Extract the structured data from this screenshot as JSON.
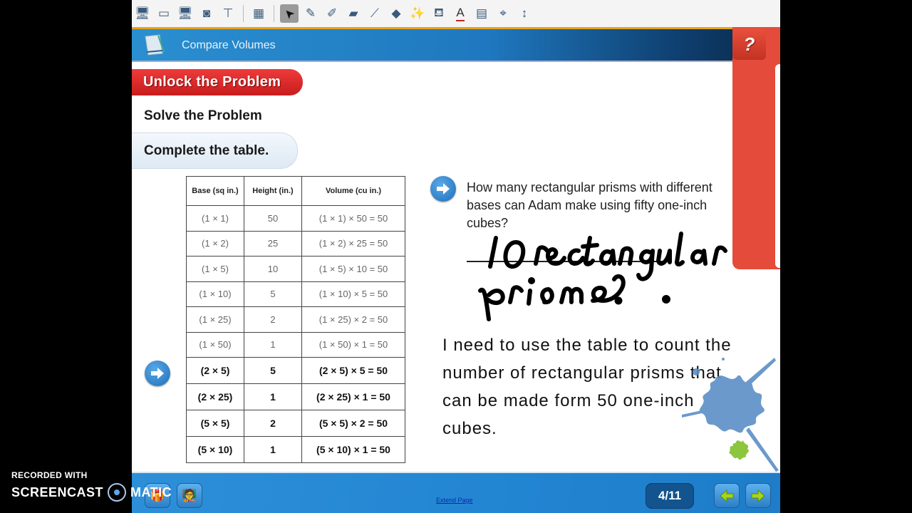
{
  "toolbar": {
    "tools": [
      {
        "icon": "monitor-blue-icon",
        "glyph": "🖥"
      },
      {
        "icon": "monitor-blank-icon",
        "glyph": "▭"
      },
      {
        "icon": "monitor-book-icon",
        "glyph": "🖥"
      },
      {
        "icon": "camera-icon",
        "glyph": "◙"
      },
      {
        "icon": "document-camera-icon",
        "glyph": "⊤"
      },
      {
        "icon": "table-icon",
        "glyph": "▦"
      },
      {
        "icon": "select-pointer-icon",
        "glyph": "➤"
      },
      {
        "icon": "pen-icon",
        "glyph": "✎"
      },
      {
        "icon": "highlighter-icon",
        "glyph": "✐"
      },
      {
        "icon": "eraser-icon",
        "glyph": "▰"
      },
      {
        "icon": "line-icon",
        "glyph": "⟋"
      },
      {
        "icon": "shapes-icon",
        "glyph": "◆"
      },
      {
        "icon": "magic-pen-icon",
        "glyph": "✨"
      },
      {
        "icon": "fill-bucket-icon",
        "glyph": "⛾"
      },
      {
        "icon": "text-icon",
        "glyph": "A"
      },
      {
        "icon": "text-format-icon",
        "glyph": "▤"
      },
      {
        "icon": "compass-icon",
        "glyph": "⌖"
      },
      {
        "icon": "resize-vertical-icon",
        "glyph": "↕"
      }
    ]
  },
  "header": {
    "title": "Compare Volumes",
    "help_label": "?"
  },
  "lesson": {
    "unlock_label": "Unlock the Problem",
    "solve_label": "Solve the Problem",
    "instruction": "Complete the table."
  },
  "table": {
    "headers": [
      "Base (sq in.)",
      "Height (in.)",
      "Volume (cu in.)"
    ],
    "rows": [
      {
        "base": "(1 × 1)",
        "height": "50",
        "volume": "(1 × 1) × 50 = 50"
      },
      {
        "base": "(1 × 2)",
        "height": "25",
        "volume": "(1 × 2) × 25 = 50"
      },
      {
        "base": "(1 × 5)",
        "height": "10",
        "volume": "(1 × 5) × 10 = 50"
      },
      {
        "base": "(1 × 10)",
        "height": "5",
        "volume": "(1 × 10) × 5 = 50"
      },
      {
        "base": "(1 × 25)",
        "height": "2",
        "volume": "(1 × 25) × 2 = 50"
      },
      {
        "base": "(1 × 50)",
        "height": "1",
        "volume": "(1 × 50) × 1 = 50"
      },
      {
        "base": "(2 × 5)",
        "height": "5",
        "volume": "(2 × 5) × 5 = 50"
      },
      {
        "base": "(2 × 25)",
        "height": "1",
        "volume": "(2 × 25) × 1 = 50"
      },
      {
        "base": "(5 × 5)",
        "height": "2",
        "volume": "(5 × 5) × 2 = 50"
      },
      {
        "base": "(5 × 10)",
        "height": "1",
        "volume": "(5 × 10) × 1 = 50"
      }
    ]
  },
  "question": {
    "text": "How many rectangular prisms with different bases can Adam make using fifty one-inch cubes?",
    "handwritten_answer": "10 rectangular prisms."
  },
  "explanation": "I need to use the table to count the number of rectangular prisms that can be made form 50 one-inch cubes.",
  "bottombar": {
    "extend_page_label": "Extend Page",
    "page_indicator": "4/11",
    "current_page": 4,
    "total_pages": 11
  },
  "watermark": {
    "line1": "RECORDED WITH",
    "line2a": "SCREENCAST",
    "line2b": "MATIC"
  },
  "colors": {
    "header_blue": "#1f78bf",
    "unlock_red": "#d92525",
    "help_red": "#e54b3a",
    "toolbar_accent": "#e7a21b",
    "splat_blue": "#5b8ec6",
    "splat_green": "#8cc63f"
  }
}
